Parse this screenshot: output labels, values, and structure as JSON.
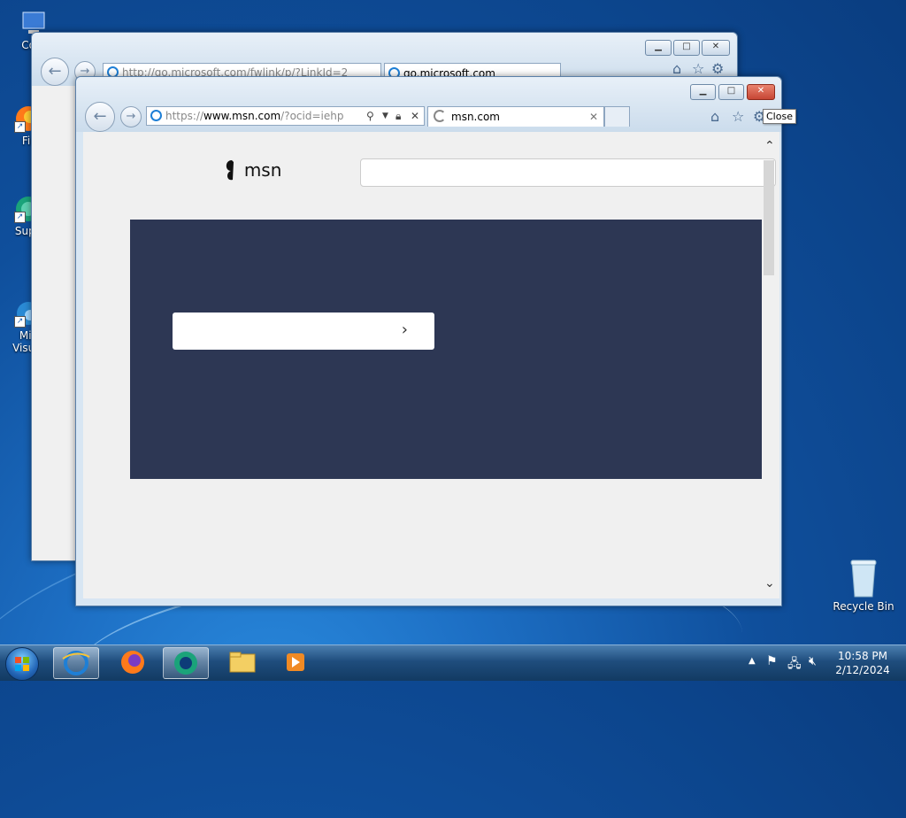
{
  "desktop": {
    "icons": [
      {
        "label": "Com"
      },
      {
        "label": "Fir"
      },
      {
        "label": "Supe"
      },
      {
        "label": "Mic"
      },
      {
        "label": "Visual"
      },
      {
        "label": "Recycle Bin"
      }
    ]
  },
  "back_window": {
    "address": "http://go.microsoft.com/fwlink/p/?LinkId=2",
    "tab_title": "go.microsoft.com"
  },
  "front_window": {
    "address_prefix": "https://",
    "address_domain": "www.msn.com",
    "address_rest": "/?ocid=iehp",
    "tab_title": "msn.com",
    "close_tooltip": "Close"
  },
  "page": {
    "logo_text": "msn",
    "search_placeholder": ""
  },
  "taskbar": {
    "time": "10:58 PM",
    "date": "2/12/2024"
  },
  "colors": {
    "hero_bg": "#2d3754",
    "page_bg": "#f0f0f0",
    "close_red": "#c74634"
  }
}
